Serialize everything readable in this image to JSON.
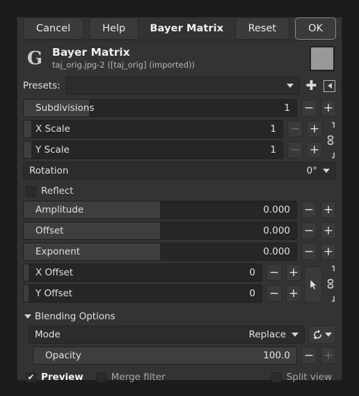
{
  "window": {
    "toolbar": {
      "cancel": "Cancel",
      "help": "Help",
      "title": "Bayer Matrix",
      "reset": "Reset",
      "ok": "OK"
    },
    "header": {
      "logo_glyph": "G",
      "title": "Bayer Matrix",
      "subtitle": "taj_orig.jpg-2 ([taj_orig] (imported))",
      "swatch_color": "#999999"
    }
  },
  "presets": {
    "label": "Presets:",
    "value": "",
    "add_icon": "plus-icon",
    "menu_icon": "preset-menu-icon"
  },
  "params": [
    {
      "name": "subdivisions",
      "label": "Subdivisions",
      "value": "1",
      "fill_pct": 24,
      "minus_dim": false,
      "plus_dim": false,
      "indent": true
    },
    {
      "name": "x-scale",
      "label": "X Scale",
      "value": "1",
      "fill_pct": 3,
      "minus_dim": true,
      "plus_dim": false,
      "indent": true
    },
    {
      "name": "y-scale",
      "label": "Y Scale",
      "value": "1",
      "fill_pct": 3,
      "minus_dim": true,
      "plus_dim": false,
      "indent": true
    },
    {
      "name": "amplitude",
      "label": "Amplitude",
      "value": "0.000",
      "fill_pct": 50,
      "minus_dim": false,
      "plus_dim": false,
      "indent": true
    },
    {
      "name": "offset",
      "label": "Offset",
      "value": "0.000",
      "fill_pct": 50,
      "minus_dim": false,
      "plus_dim": false,
      "indent": true
    },
    {
      "name": "exponent",
      "label": "Exponent",
      "value": "0.000",
      "fill_pct": 50,
      "minus_dim": false,
      "plus_dim": false,
      "indent": true
    },
    {
      "name": "x-offset",
      "label": "X Offset",
      "value": "0",
      "fill_pct": 2,
      "minus_dim": false,
      "plus_dim": false,
      "indent": true
    },
    {
      "name": "y-offset",
      "label": "Y Offset",
      "value": "0",
      "fill_pct": 2,
      "minus_dim": false,
      "plus_dim": false,
      "indent": true
    }
  ],
  "rotation": {
    "label": "Rotation",
    "value": "0°"
  },
  "reflect": {
    "label": "Reflect",
    "checked": false
  },
  "blending": {
    "section_label": "Blending Options",
    "mode_label": "Mode",
    "mode_value": "Replace",
    "reset_icon": "blend-reset-icon",
    "opacity_label": "Opacity",
    "opacity_value": "100.0",
    "opacity_fill_pct": 100
  },
  "footer": {
    "preview": {
      "label": "Preview",
      "checked": true
    },
    "merge_filter": {
      "label": "Merge filter",
      "checked": false
    },
    "split_view": {
      "label": "Split view",
      "checked": false
    }
  },
  "icons": {
    "chain": "chain-link-icon",
    "picker": "pointer-picker-icon"
  }
}
